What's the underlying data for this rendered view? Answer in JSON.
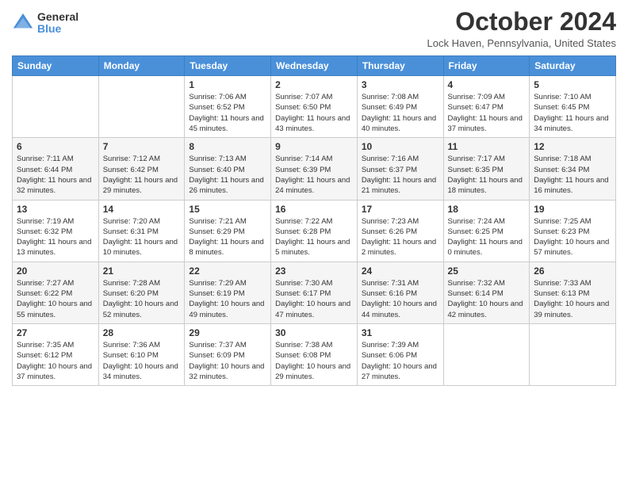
{
  "header": {
    "logo": {
      "general": "General",
      "blue": "Blue"
    },
    "title": "October 2024",
    "location": "Lock Haven, Pennsylvania, United States"
  },
  "days_of_week": [
    "Sunday",
    "Monday",
    "Tuesday",
    "Wednesday",
    "Thursday",
    "Friday",
    "Saturday"
  ],
  "weeks": [
    [
      {
        "day": "",
        "content": ""
      },
      {
        "day": "",
        "content": ""
      },
      {
        "day": "1",
        "content": "Sunrise: 7:06 AM\nSunset: 6:52 PM\nDaylight: 11 hours and 45 minutes."
      },
      {
        "day": "2",
        "content": "Sunrise: 7:07 AM\nSunset: 6:50 PM\nDaylight: 11 hours and 43 minutes."
      },
      {
        "day": "3",
        "content": "Sunrise: 7:08 AM\nSunset: 6:49 PM\nDaylight: 11 hours and 40 minutes."
      },
      {
        "day": "4",
        "content": "Sunrise: 7:09 AM\nSunset: 6:47 PM\nDaylight: 11 hours and 37 minutes."
      },
      {
        "day": "5",
        "content": "Sunrise: 7:10 AM\nSunset: 6:45 PM\nDaylight: 11 hours and 34 minutes."
      }
    ],
    [
      {
        "day": "6",
        "content": "Sunrise: 7:11 AM\nSunset: 6:44 PM\nDaylight: 11 hours and 32 minutes."
      },
      {
        "day": "7",
        "content": "Sunrise: 7:12 AM\nSunset: 6:42 PM\nDaylight: 11 hours and 29 minutes."
      },
      {
        "day": "8",
        "content": "Sunrise: 7:13 AM\nSunset: 6:40 PM\nDaylight: 11 hours and 26 minutes."
      },
      {
        "day": "9",
        "content": "Sunrise: 7:14 AM\nSunset: 6:39 PM\nDaylight: 11 hours and 24 minutes."
      },
      {
        "day": "10",
        "content": "Sunrise: 7:16 AM\nSunset: 6:37 PM\nDaylight: 11 hours and 21 minutes."
      },
      {
        "day": "11",
        "content": "Sunrise: 7:17 AM\nSunset: 6:35 PM\nDaylight: 11 hours and 18 minutes."
      },
      {
        "day": "12",
        "content": "Sunrise: 7:18 AM\nSunset: 6:34 PM\nDaylight: 11 hours and 16 minutes."
      }
    ],
    [
      {
        "day": "13",
        "content": "Sunrise: 7:19 AM\nSunset: 6:32 PM\nDaylight: 11 hours and 13 minutes."
      },
      {
        "day": "14",
        "content": "Sunrise: 7:20 AM\nSunset: 6:31 PM\nDaylight: 11 hours and 10 minutes."
      },
      {
        "day": "15",
        "content": "Sunrise: 7:21 AM\nSunset: 6:29 PM\nDaylight: 11 hours and 8 minutes."
      },
      {
        "day": "16",
        "content": "Sunrise: 7:22 AM\nSunset: 6:28 PM\nDaylight: 11 hours and 5 minutes."
      },
      {
        "day": "17",
        "content": "Sunrise: 7:23 AM\nSunset: 6:26 PM\nDaylight: 11 hours and 2 minutes."
      },
      {
        "day": "18",
        "content": "Sunrise: 7:24 AM\nSunset: 6:25 PM\nDaylight: 11 hours and 0 minutes."
      },
      {
        "day": "19",
        "content": "Sunrise: 7:25 AM\nSunset: 6:23 PM\nDaylight: 10 hours and 57 minutes."
      }
    ],
    [
      {
        "day": "20",
        "content": "Sunrise: 7:27 AM\nSunset: 6:22 PM\nDaylight: 10 hours and 55 minutes."
      },
      {
        "day": "21",
        "content": "Sunrise: 7:28 AM\nSunset: 6:20 PM\nDaylight: 10 hours and 52 minutes."
      },
      {
        "day": "22",
        "content": "Sunrise: 7:29 AM\nSunset: 6:19 PM\nDaylight: 10 hours and 49 minutes."
      },
      {
        "day": "23",
        "content": "Sunrise: 7:30 AM\nSunset: 6:17 PM\nDaylight: 10 hours and 47 minutes."
      },
      {
        "day": "24",
        "content": "Sunrise: 7:31 AM\nSunset: 6:16 PM\nDaylight: 10 hours and 44 minutes."
      },
      {
        "day": "25",
        "content": "Sunrise: 7:32 AM\nSunset: 6:14 PM\nDaylight: 10 hours and 42 minutes."
      },
      {
        "day": "26",
        "content": "Sunrise: 7:33 AM\nSunset: 6:13 PM\nDaylight: 10 hours and 39 minutes."
      }
    ],
    [
      {
        "day": "27",
        "content": "Sunrise: 7:35 AM\nSunset: 6:12 PM\nDaylight: 10 hours and 37 minutes."
      },
      {
        "day": "28",
        "content": "Sunrise: 7:36 AM\nSunset: 6:10 PM\nDaylight: 10 hours and 34 minutes."
      },
      {
        "day": "29",
        "content": "Sunrise: 7:37 AM\nSunset: 6:09 PM\nDaylight: 10 hours and 32 minutes."
      },
      {
        "day": "30",
        "content": "Sunrise: 7:38 AM\nSunset: 6:08 PM\nDaylight: 10 hours and 29 minutes."
      },
      {
        "day": "31",
        "content": "Sunrise: 7:39 AM\nSunset: 6:06 PM\nDaylight: 10 hours and 27 minutes."
      },
      {
        "day": "",
        "content": ""
      },
      {
        "day": "",
        "content": ""
      }
    ]
  ]
}
